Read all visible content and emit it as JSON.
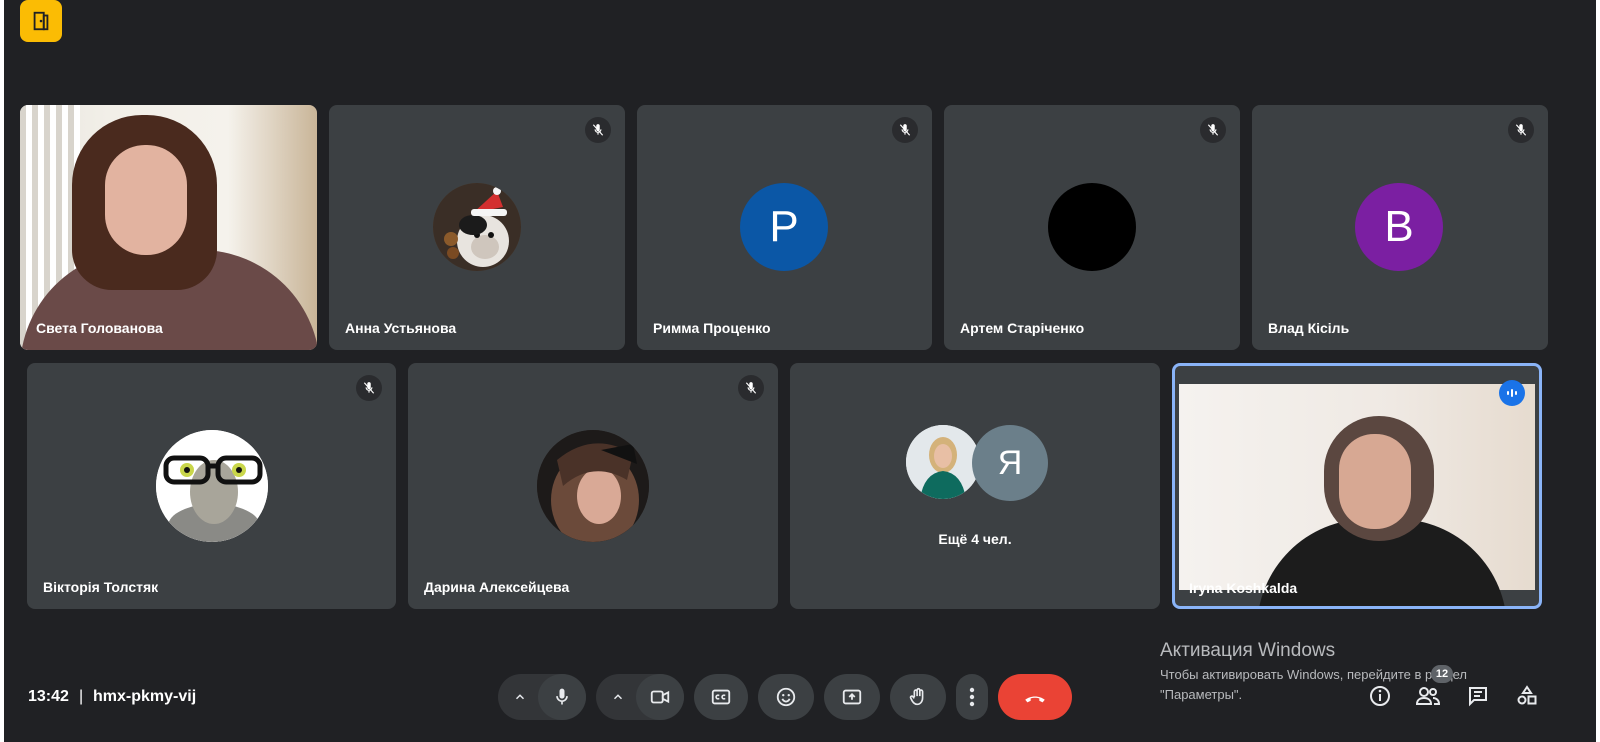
{
  "participants": [
    {
      "name": "Света Голованова"
    },
    {
      "name": "Анна Устьянова"
    },
    {
      "name": "Римма Проценко",
      "initial": "P"
    },
    {
      "name": "Артем Старіченко"
    },
    {
      "name": "Влад Кісіль",
      "initial": "B"
    },
    {
      "name": "Вікторія Толстяк"
    },
    {
      "name": "Дарина Алексейцева"
    },
    {
      "name": "Iryna Koshkalda"
    }
  ],
  "others": {
    "avatar_initial": "Я",
    "label": "Ещё 4 чел."
  },
  "windows_watermark": {
    "title": "Активация Windows",
    "line1": "Чтобы активировать Windows, перейдите в раздел",
    "line2": "\"Параметры\"."
  },
  "bottom_bar": {
    "time": "13:42",
    "separator": "|",
    "meeting_code": "hmx-pkmy-vij"
  },
  "people_count": "12",
  "colors": {
    "background": "#202124",
    "tile": "#3c4043",
    "accent_blue": "#1a73e8",
    "hangup_red": "#ea4335",
    "avatar_p": "#0b57a6",
    "avatar_b": "#7b1fa2",
    "avatar_ya": "#6b7f8a",
    "top_icon": "#fbbc04"
  }
}
